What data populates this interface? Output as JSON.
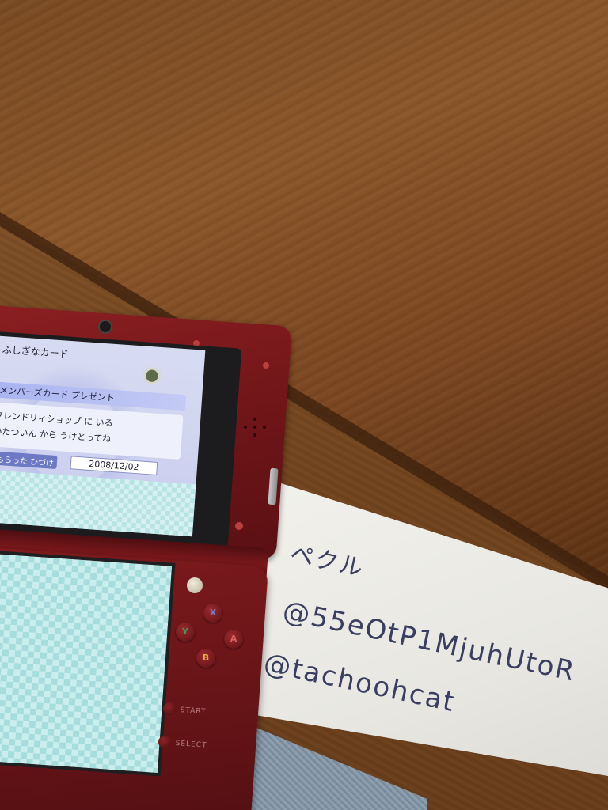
{
  "upper_screen": {
    "card_title": "ふしぎなカード",
    "event_title": "メンバーズカード プレゼント",
    "description_line1": "フレンドリィショップ に いる",
    "description_line2": "いたついん から うけとってね",
    "received_label": "もらった ひづけ",
    "received_date": "2008/12/02"
  },
  "buttons": {
    "x": "X",
    "y": "Y",
    "a": "A",
    "b": "B",
    "start": "START",
    "select": "SELECT"
  },
  "note": {
    "line1": "ペクル",
    "line2": "@55eOtP1MjuhUtoR",
    "line3": "@tachoohcat"
  },
  "colors": {
    "console": "#7a181c",
    "wood": "#7b4620",
    "paper": "#ecebe6",
    "ink": "#3a3f62"
  }
}
